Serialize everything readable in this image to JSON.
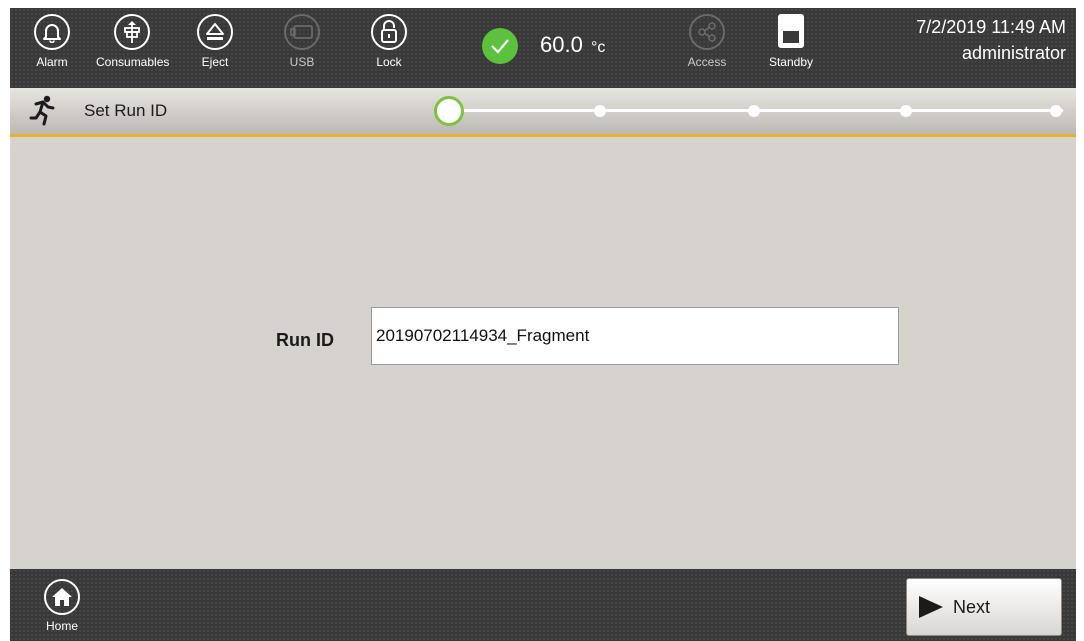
{
  "topbar": {
    "buttons": [
      {
        "label": "Alarm",
        "icon": "bell-icon"
      },
      {
        "label": "Consumables",
        "icon": "consumables-icon"
      },
      {
        "label": "Eject",
        "icon": "eject-icon"
      },
      {
        "label": "USB",
        "icon": "usb-icon",
        "disabled": true
      },
      {
        "label": "Lock",
        "icon": "unlock-icon"
      },
      {
        "label": "Access",
        "icon": "share-icon",
        "disabled": true
      },
      {
        "label": "Standby",
        "icon": "standby-icon"
      }
    ],
    "temperature": {
      "value": "60.0",
      "unit": "°c",
      "status_icon": "check-icon",
      "status_color": "#5cc13c"
    },
    "datetime": "7/2/2019 11:49 AM",
    "user": "administrator"
  },
  "titlebar": {
    "title": "Set Run ID",
    "icon": "running-person-icon",
    "steps": {
      "total": 5,
      "current": 1
    },
    "accent_color": "#e8b130"
  },
  "main": {
    "run_id_label": "Run ID",
    "run_id_value": "20190702114934_Fragment"
  },
  "bottombar": {
    "home_label": "Home",
    "next_label": "Next"
  }
}
